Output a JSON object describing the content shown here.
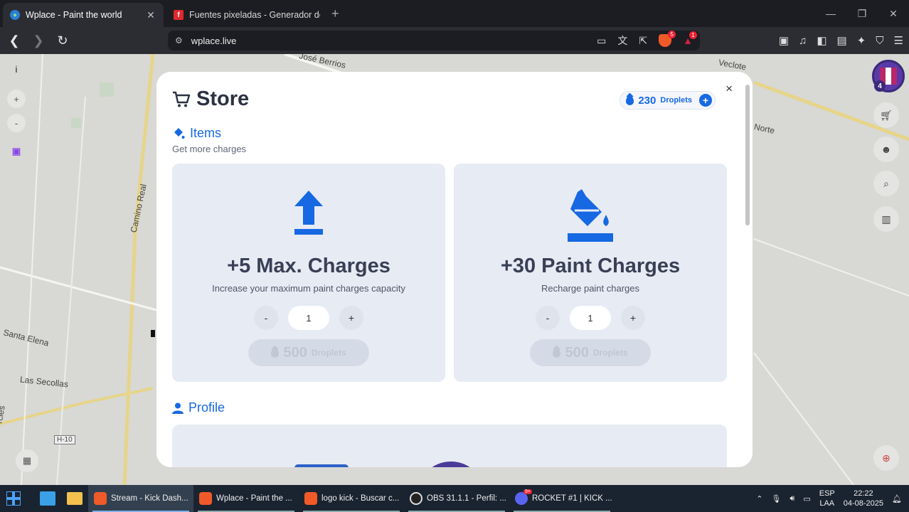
{
  "browser": {
    "tabs": [
      {
        "title": "Wplace - Paint the world",
        "active": true,
        "favicon": "globe-icon"
      },
      {
        "title": "Fuentes pixeladas - Generador de fue",
        "active": false,
        "favicon": "fontawesome-f-icon"
      }
    ],
    "new_tab_label": "+",
    "url": "wplace.live",
    "brave_badge": "5",
    "alert_badge": "1"
  },
  "map": {
    "labels": [
      "José Berrios",
      "Veclote",
      "Norte",
      "Camino Real",
      "Santa Elena",
      "Las Secollas",
      "H-10",
      "rcles"
    ],
    "zoom_in": "+",
    "zoom_out": "-",
    "info": "i",
    "avatar_level": "4"
  },
  "store": {
    "title": "Store",
    "droplets": {
      "amount": "230",
      "unit": "Droplets",
      "add": "+"
    },
    "close": "×",
    "items_section": {
      "title": "Items",
      "subtitle": "Get more charges"
    },
    "items": [
      {
        "name": "+5 Max. Charges",
        "description": "Increase your maximum paint charges capacity",
        "quantity": "1",
        "minus": "-",
        "plus": "+",
        "price": "500",
        "price_unit": "Droplets",
        "icon": "upload-arrow-icon"
      },
      {
        "name": "+30 Paint Charges",
        "description": "Recharge paint charges",
        "quantity": "1",
        "minus": "-",
        "plus": "+",
        "price": "500",
        "price_unit": "Droplets",
        "icon": "paint-bucket-icon"
      }
    ],
    "profile_section": {
      "title": "Profile"
    }
  },
  "taskbar": {
    "apps": [
      {
        "label": "Stream - Kick Dash...",
        "active": true
      },
      {
        "label": "Wplace - Paint the ...",
        "active": false
      },
      {
        "label": "logo kick - Buscar c...",
        "active": false
      },
      {
        "label": "OBS 31.1.1 - Perfil: ...",
        "active": false
      },
      {
        "label": "ROCKET #1 | KICK ...",
        "active": false
      }
    ],
    "discord_badge": "9+",
    "lang_top": "ESP",
    "lang_bottom": "LAA",
    "time": "22:22",
    "date": "04-08-2025"
  },
  "colors": {
    "accent": "#1668e3",
    "card_bg": "#e7ebf4",
    "taskbar": "#1a2330",
    "chrome": "#2c2d33"
  }
}
